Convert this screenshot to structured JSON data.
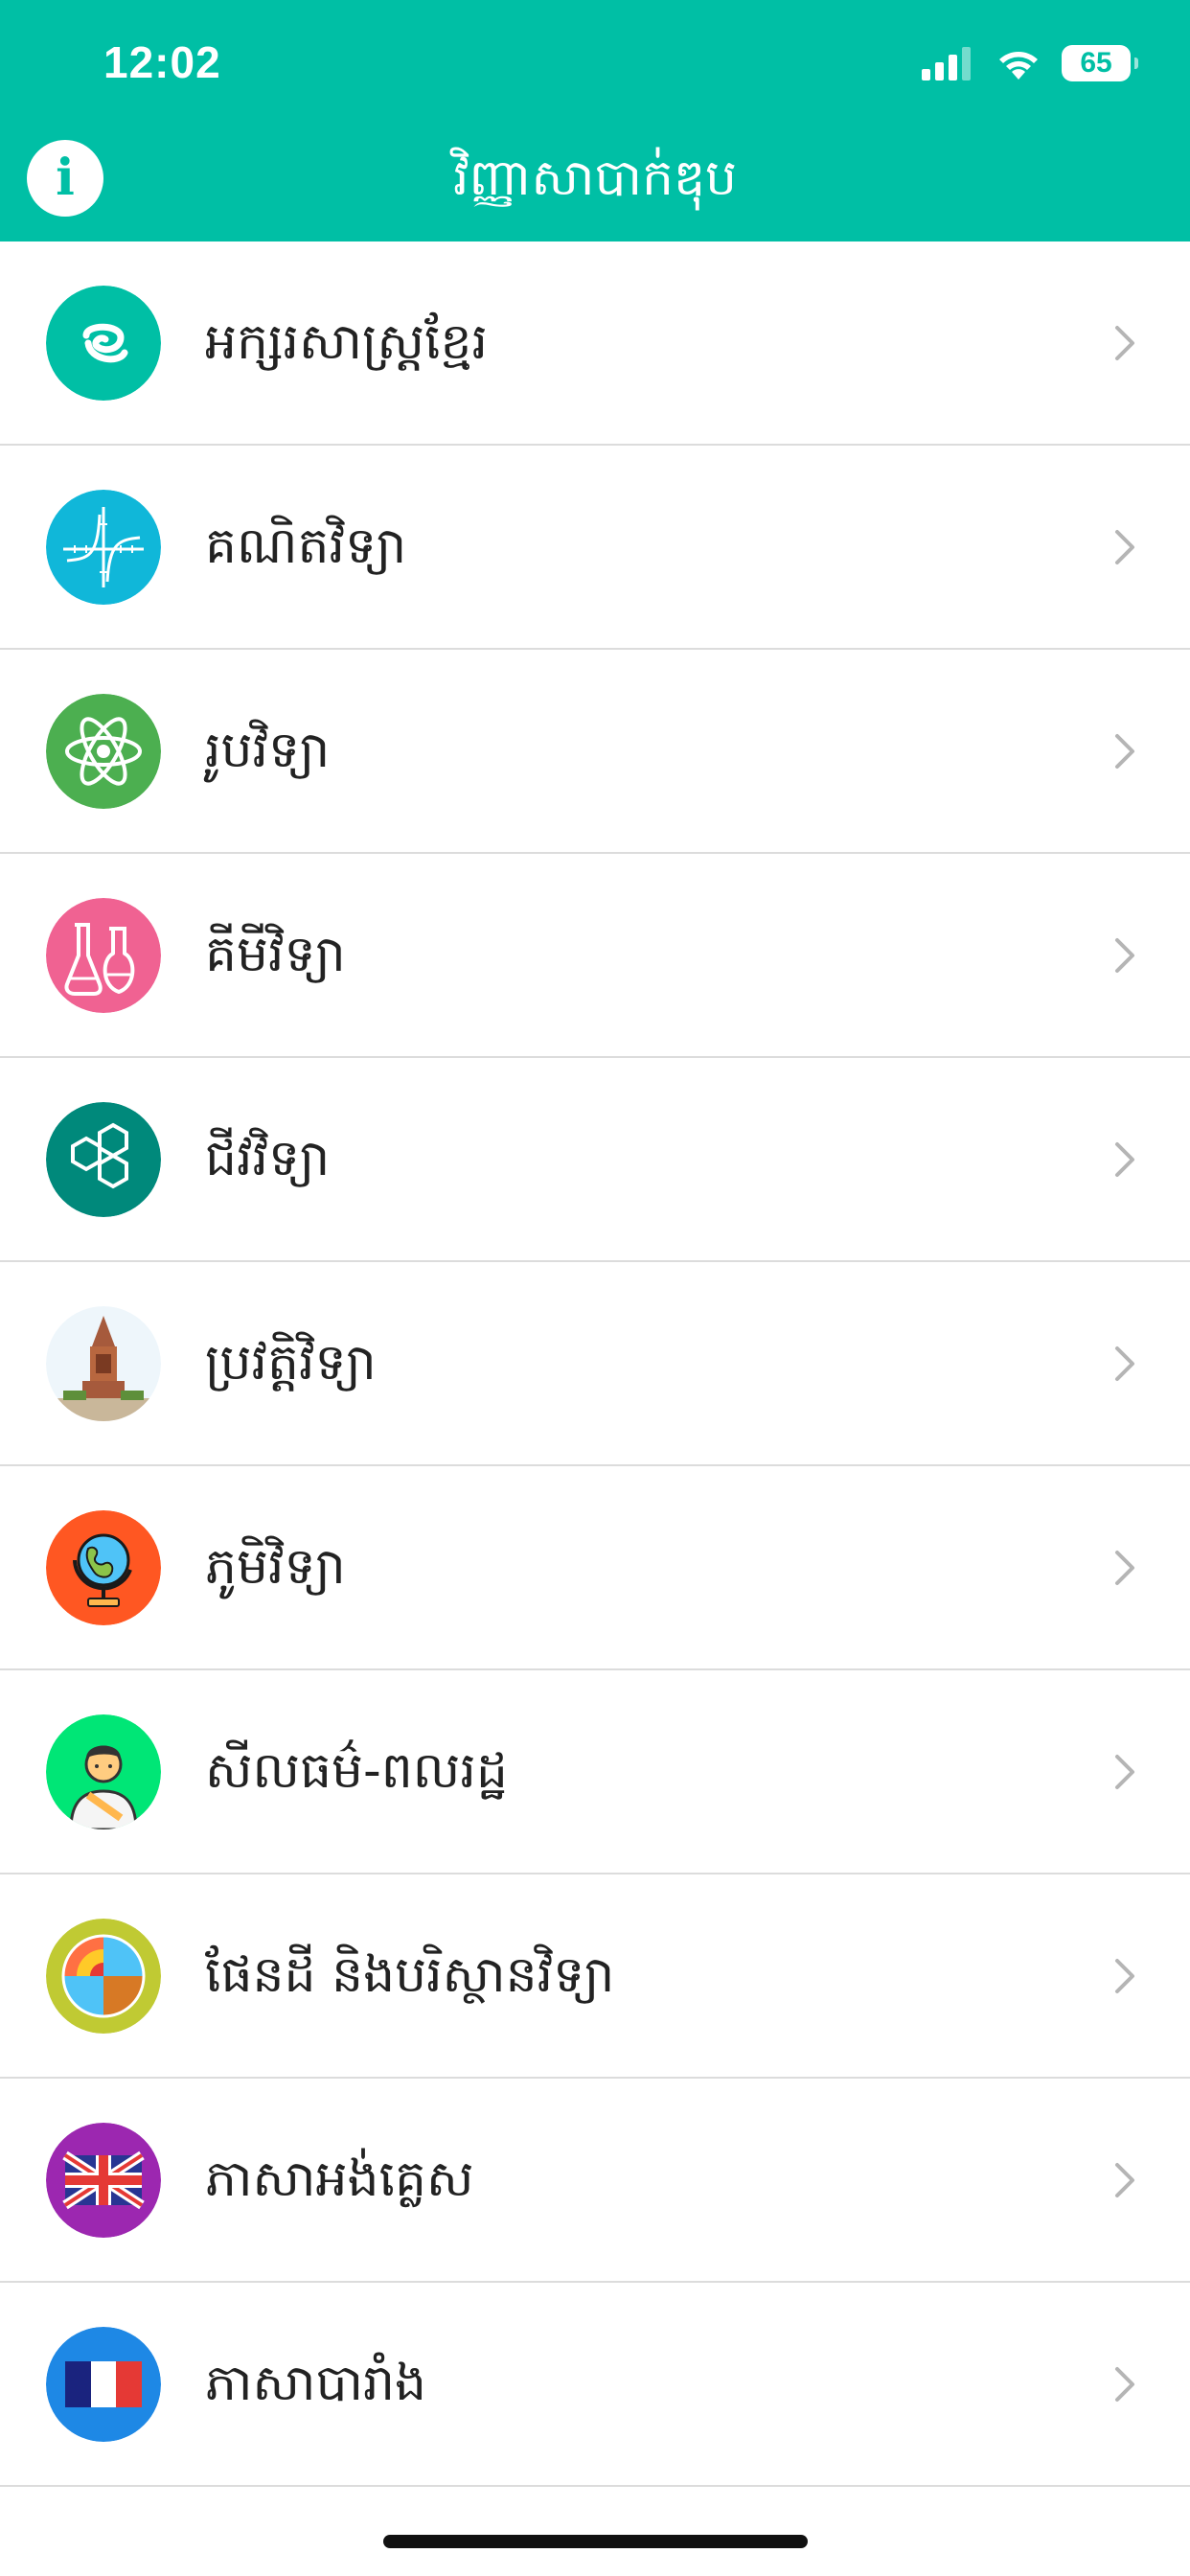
{
  "status_bar": {
    "time": "12:02",
    "battery": "65",
    "icons": [
      "cellular-signal-icon",
      "wifi-icon",
      "battery-icon"
    ]
  },
  "header": {
    "title": "វិញ្ញាសាបាក់ឌុប",
    "info_icon": "i",
    "background_color": "#00bfa5"
  },
  "subjects": [
    {
      "label": "អក្សរសាស្ត្រខ្មែរ",
      "icon": "khmer-letter-icon",
      "color": "#00bfa5"
    },
    {
      "label": "គណិតវិទ្យា",
      "icon": "graph-icon",
      "color": "#10b7d9"
    },
    {
      "label": "រូបវិទ្យា",
      "icon": "atom-icon",
      "color": "#4caf50"
    },
    {
      "label": "គីមីវិទ្យា",
      "icon": "flask-icon",
      "color": "#f06292"
    },
    {
      "label": "ជីវវិទ្យា",
      "icon": "molecule-icon",
      "color": "#00897b"
    },
    {
      "label": "ប្រវត្តិវិទ្យា",
      "icon": "monument-icon",
      "color": "#eef6fb"
    },
    {
      "label": "ភូមិវិទ្យា",
      "icon": "globe-icon",
      "color": "#ff5722"
    },
    {
      "label": "សីលធម៌-ពលរដ្ឋ",
      "icon": "citizen-icon",
      "color": "#00e676"
    },
    {
      "label": "ផែនដី និងបរិស្ថានវិទ្យា",
      "icon": "earth-layers-icon",
      "color": "#c0ca33"
    },
    {
      "label": "ភាសាអង់គ្លេស",
      "icon": "uk-flag-icon",
      "color": "#9c27b0"
    },
    {
      "label": "ភាសាបារាំង",
      "icon": "france-flag-icon",
      "color": "#1e88e5"
    }
  ]
}
